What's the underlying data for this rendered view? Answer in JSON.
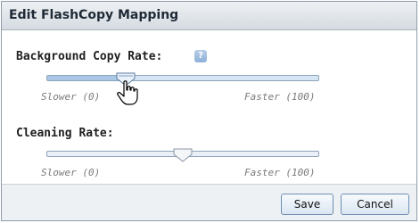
{
  "dialog": {
    "title": "Edit FlashCopy Mapping"
  },
  "background_copy_rate": {
    "label": "Background Copy Rate:",
    "help_icon": "question-mark-icon",
    "help_glyph": "?",
    "value_percent": 29,
    "min_label": "Slower (0)",
    "max_label": "Faster (100)"
  },
  "cleaning_rate": {
    "label": "Cleaning Rate:",
    "value_percent": 50,
    "min_label": "Slower (0)",
    "max_label": "Faster (100)"
  },
  "footer": {
    "save_label": "Save",
    "cancel_label": "Cancel"
  },
  "colors": {
    "accent": "#a9c6e4",
    "button_border": "#6d8fb5"
  }
}
